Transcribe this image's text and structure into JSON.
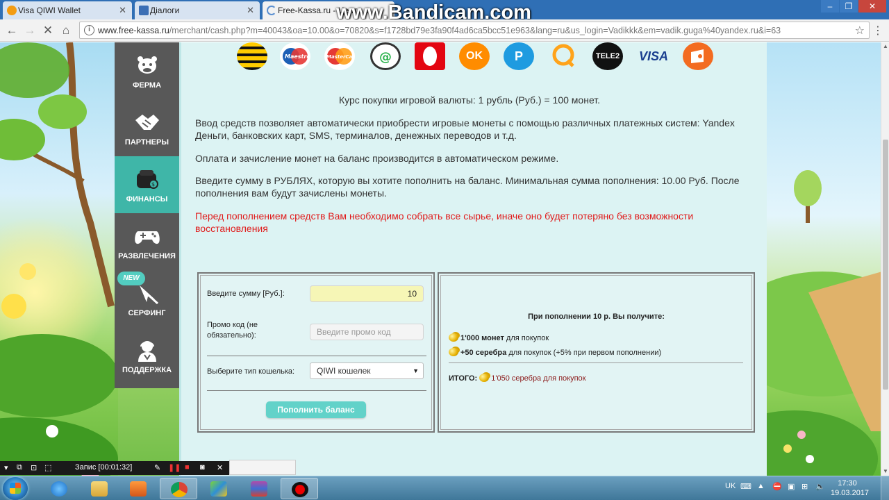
{
  "browser": {
    "tabs": [
      {
        "title": "Visa QIWI Wallet",
        "icon": "qiwi-favicon"
      },
      {
        "title": "Діалоги",
        "icon": "dialogs-favicon"
      },
      {
        "title": "Free-Kassa.ru - Центр ...",
        "icon": "loading-spinner-icon"
      }
    ],
    "url_host": "www.free-kassa.ru",
    "url_path": "/merchant/cash.php?m=40043&oa=10.00&o=70820&s=f1728bd79e3fa90f4ad6ca5bcc51e963&lang=ru&us_login=Vadikkk&em=vadik.guga%40yandex.ru&i=63",
    "watermark": "www.Bandicam.com"
  },
  "sidebar": {
    "items": [
      {
        "label": "ФЕРМА",
        "icon": "cow-icon"
      },
      {
        "label": "ПАРТНЕРЫ",
        "icon": "handshake-icon"
      },
      {
        "label": "ФИНАНСЫ",
        "icon": "wallet-icon",
        "active": true
      },
      {
        "label": "РАЗВЛЕЧЕНИЯ",
        "icon": "gamepad-icon"
      },
      {
        "label": "СЕРФИНГ",
        "icon": "cursor-icon",
        "badge": "NEW"
      },
      {
        "label": "ПОДДЕРЖКА",
        "icon": "support-operator-icon"
      }
    ]
  },
  "payment_methods": [
    "Beeline",
    "Maestro",
    "MasterCard",
    "MegaFon",
    "MTS",
    "OK",
    "P",
    "QIWI",
    "TELE2",
    "VISA",
    "Yandex"
  ],
  "content": {
    "rate": "Курс покупки игровой валюты: 1 рубль (Руб.) = 100 монет.",
    "para1": "Ввод средств позволяет автоматически приобрести игровые монеты с помощью различных платежных систем: Yandex Деньги, банковских карт, SMS, терминалов, денежных переводов и т.д.",
    "para2": "Оплата и зачисление монет на баланс производится в автоматическом режиме.",
    "para3": "Введите сумму в РУБЛЯХ, которую вы хотите пополнить на баланс. Минимальная сумма пополнения: 10.00 Руб. После пополнения вам будут зачислены монеты.",
    "warning": "Перед пополнением средств Вам необходимо собрать все сырье, иначе оно будет потеряно без возможности восстановления"
  },
  "form": {
    "amount_label": "Введите сумму [Руб.]:",
    "amount_value": "10",
    "promo_label": "Промо код (не обязательно):",
    "promo_placeholder": "Введите промо код",
    "wallet_label": "Выберите тип кошелька:",
    "wallet_value": "QIWI кошелек",
    "submit_label": "Пополнить баланс"
  },
  "result": {
    "title": "При пополнении 10 р. Вы получите:",
    "line1_bold": "1'000 монет",
    "line1_rest": "для покупок",
    "line2_bold": "+50 серебра",
    "line2_rest": "для покупок (+5% при первом пополнении)",
    "total_label": "ИТОГО:",
    "total_value": "1'050 серебра для покупок"
  },
  "recorder": {
    "status": "Запис [00:01:32]"
  },
  "taskbar": {
    "lang": "UK",
    "time": "17:30",
    "date": "19.03.2017"
  },
  "colors": {
    "sidebar_bg": "#585858",
    "sidebar_active": "#3fb6a8",
    "content_bg": "#dcf3f3",
    "warning_text": "#e01b1b",
    "button_bg": "#62d2c9"
  }
}
